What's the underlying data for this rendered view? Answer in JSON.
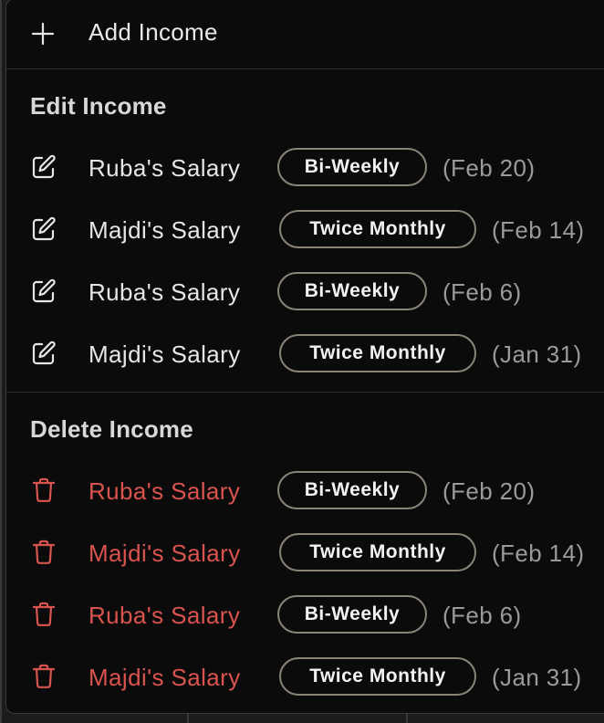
{
  "menu": {
    "add_label": "Add Income",
    "edit_section_title": "Edit Income",
    "delete_section_title": "Delete Income",
    "edit_items": [
      {
        "name": "Ruba's Salary",
        "frequency": "Bi-Weekly",
        "date": "(Feb 20)"
      },
      {
        "name": "Majdi's Salary",
        "frequency": "Twice Monthly",
        "date": "(Feb 14)"
      },
      {
        "name": "Ruba's Salary",
        "frequency": "Bi-Weekly",
        "date": "(Feb 6)"
      },
      {
        "name": "Majdi's Salary",
        "frequency": "Twice Monthly",
        "date": "(Jan 31)"
      }
    ],
    "delete_items": [
      {
        "name": "Ruba's Salary",
        "frequency": "Bi-Weekly",
        "date": "(Feb 20)"
      },
      {
        "name": "Majdi's Salary",
        "frequency": "Twice Monthly",
        "date": "(Feb 14)"
      },
      {
        "name": "Ruba's Salary",
        "frequency": "Bi-Weekly",
        "date": "(Feb 6)"
      },
      {
        "name": "Majdi's Salary",
        "frequency": "Twice Monthly",
        "date": "(Jan 31)"
      }
    ]
  },
  "icons": {
    "add": "plus-icon",
    "edit": "edit-pencil-icon",
    "delete": "trash-icon"
  },
  "colors": {
    "menu_background": "#0b0b0c",
    "text_primary": "#e6e6e8",
    "text_muted": "#9a9a9c",
    "danger": "#d9534f",
    "badge_border": "#8a8478"
  }
}
